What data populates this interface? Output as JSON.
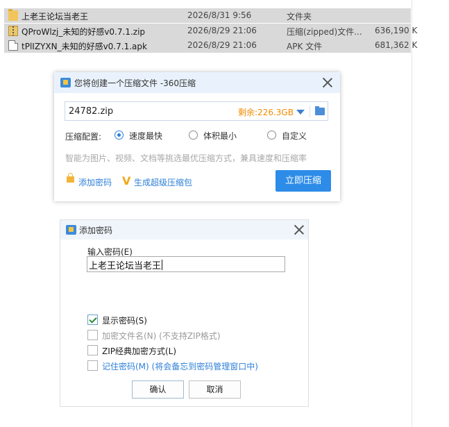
{
  "explorer": {
    "files": [
      {
        "name": "上老王论坛当老王",
        "date": "2026/8/31 9:56",
        "type": "文件夹",
        "size": "",
        "icon": "folder-icon"
      },
      {
        "name": "QProWlzj_未知的好感v0.7.1.zip",
        "date": "2026/8/29 21:06",
        "type": "压缩(zipped)文件...",
        "size": "636,190 K",
        "icon": "zip-icon"
      },
      {
        "name": "tPlIZYXN_未知的好感v0.7.1.apk",
        "date": "2026/8/29 21:06",
        "type": "APK 文件",
        "size": "681,362 K",
        "icon": "apk-file-icon"
      }
    ]
  },
  "compress_dialog": {
    "title": "您将创建一个压缩文件 -360压缩",
    "filename": "24782.zip",
    "remaining": "剩余:226.3GB",
    "config_label": "压缩配置:",
    "options": [
      {
        "label": "速度最快",
        "selected": true
      },
      {
        "label": "体积最小",
        "selected": false
      },
      {
        "label": "自定义",
        "selected": false
      }
    ],
    "hint": "智能为图片、视频、文档等挑选最优压缩方式，兼具速度和压缩率",
    "add_password": "添加密码",
    "super_package": "生成超级压缩包",
    "compress_button": "立即压缩",
    "accent_color": "#2d8ce8",
    "remaining_color": "#f08a00"
  },
  "password_dialog": {
    "title": "添加密码",
    "input_label": "输入密码(E)",
    "password_value": "上老王论坛当老王",
    "options": [
      {
        "label": "显示密码(S)",
        "checked": true,
        "enabled": true
      },
      {
        "label": "加密文件名(N) (不支持ZIP格式)",
        "checked": false,
        "enabled": false
      },
      {
        "label": "ZIP经典加密方式(L)",
        "checked": false,
        "enabled": true
      },
      {
        "label": "记住密码(M) (将会备忘到密码管理窗口中)",
        "checked": false,
        "enabled": true
      }
    ],
    "ok_button": "确认",
    "cancel_button": "取消"
  }
}
